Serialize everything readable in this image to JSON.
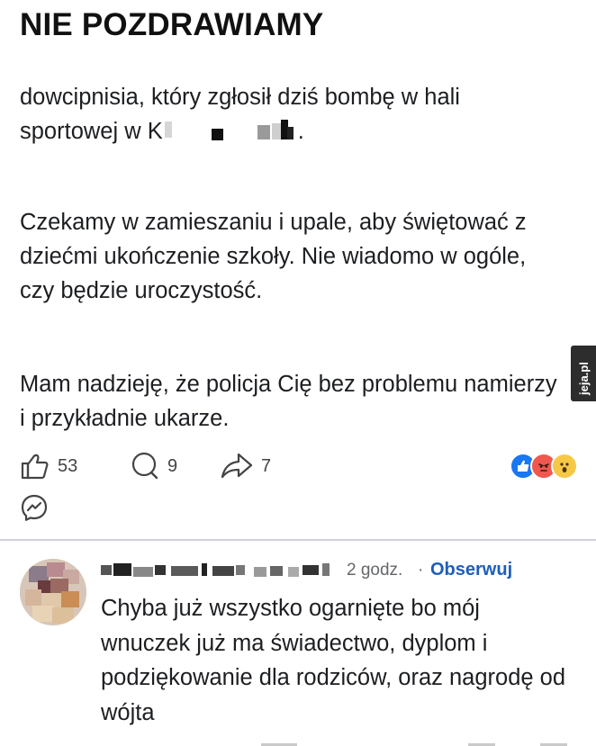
{
  "post": {
    "title": "NIE POZDRAWIAMY",
    "paragraph1_line1": "dowcipnisia, który zgłosił dziś bombę w hali",
    "paragraph1_line2_start": "sportowej w K",
    "paragraph1_line2_end": ".",
    "paragraph2": "Czekamy w zamieszaniu i upale, aby świętować z dziećmi ukończenie szkoły.  Nie wiadomo w ogóle, czy będzie uroczystość.",
    "paragraph3": "Mam nadzieję, że policja Cię bez problemu namierzy i przykładnie ukarze."
  },
  "actions": {
    "like_count": "53",
    "comment_count": "9",
    "share_count": "7",
    "reaction_icons": [
      "like-icon",
      "angry-icon",
      "wow-icon"
    ]
  },
  "watermark": {
    "text": "jeja.pl"
  },
  "comment": {
    "time": "2 godz.",
    "separator": "·",
    "follow_label": "Obserwuj",
    "text": "Chyba już wszystko ogarnięte bo mój wnuczek już ma świadectwo, dyplom i podziękowanie dla rodziców, oraz nagrodę od wójta"
  },
  "colors": {
    "accent_blue": "#1f5eb8",
    "like_blue": "#1877f2",
    "angry_orange": "#f0574f",
    "wow_yellow": "#f7c846",
    "muted_gray": "#65676b"
  }
}
